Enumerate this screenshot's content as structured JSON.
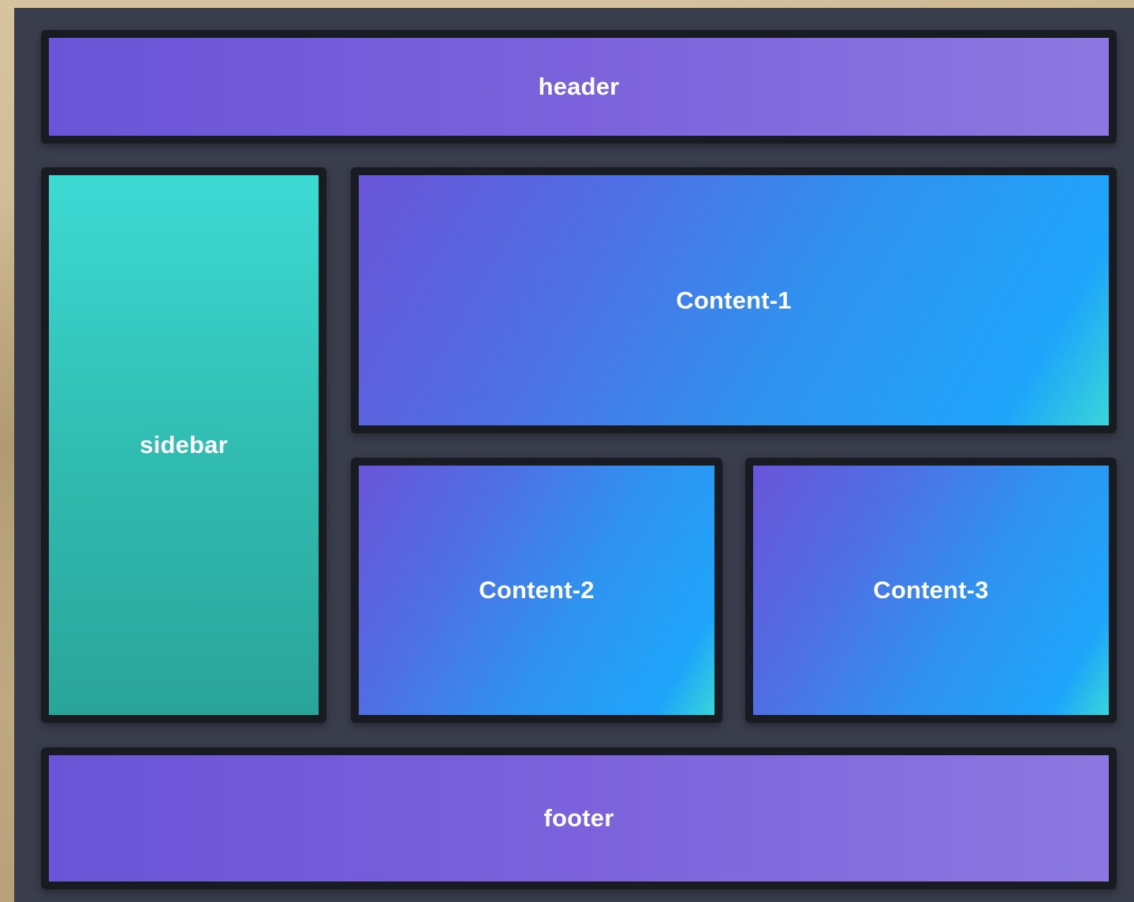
{
  "layout": {
    "header": {
      "label": "header"
    },
    "sidebar": {
      "label": "sidebar"
    },
    "content": [
      {
        "label": "Content-1"
      },
      {
        "label": "Content-2"
      },
      {
        "label": "Content-3"
      }
    ],
    "footer": {
      "label": "footer"
    }
  },
  "colors": {
    "frame_background": "#3a3d4c",
    "panel_border": "#191b22",
    "header_footer_gradient": [
      "#6a55d8",
      "#8c78e0"
    ],
    "sidebar_gradient": [
      "#3ddad4",
      "#2aa49a"
    ],
    "content_gradient": [
      "#6a55d8",
      "#1ea5fa",
      "#38d6d8"
    ],
    "text": "#ffffff"
  }
}
